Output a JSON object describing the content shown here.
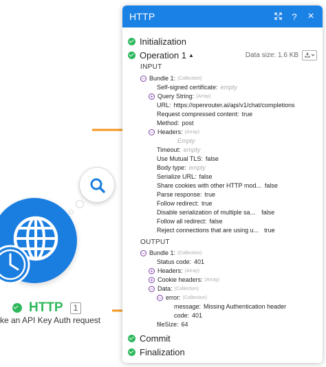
{
  "panel": {
    "title": "HTTP",
    "header_icons": [
      "expand-icon",
      "help-icon",
      "close-icon"
    ],
    "help_label": "?",
    "close_label": "×",
    "accent_color": "#1b82e5",
    "success_color": "#2eb85c",
    "sections": {
      "initialization": "Initialization",
      "operation": "Operation 1",
      "data_size": "Data size: 1.6 KB",
      "commit": "Commit",
      "finalization": "Finalization"
    },
    "input_label": "INPUT",
    "output_label": "OUTPUT",
    "input": {
      "bundle": "Bundle 1:",
      "bundle_tag": "(Collection)",
      "self_signed": "Self-signed certificate:",
      "empty": "empty",
      "query_string": "Query String:",
      "array_tag": "(Array)",
      "url_label": "URL:",
      "url_value": "https://openrouter.ai/api/v1/chat/completions",
      "request_compressed": "Request compressed content:",
      "true_value": "true",
      "false_value": "false",
      "method_label": "Method:",
      "method_value": "post",
      "headers": "Headers:",
      "headers_empty": "Empty",
      "timeout": "Timeout:",
      "use_mutual_tls": "Use Mutual TLS:",
      "body_type": "Body type:",
      "serialize_url": "Serialize URL:",
      "share_cookies": "Share cookies with other HTTP mod...",
      "parse_response": "Parse response:",
      "follow_redirect": "Follow redirect:",
      "disable_serialization": "Disable serialization of multiple sa...",
      "follow_all_redirect": "Follow all redirect:",
      "reject_connections": "Reject connections that are using u..."
    },
    "output": {
      "bundle": "Bundle 1:",
      "bundle_tag": "(Collection)",
      "status_code_label": "Status code:",
      "status_code_value": "401",
      "headers": "Headers:",
      "array_tag": "(Array)",
      "cookie_headers": "Cookie headers:",
      "data": "Data:",
      "collection_tag": "(Collection)",
      "error": "error:",
      "message_label": "message:",
      "message_value": "Missing Authentication header",
      "code_label": "code:",
      "code_value": "401",
      "filesize_label": "fileSize:",
      "filesize_value": "64"
    }
  },
  "module": {
    "name": "HTTP",
    "count": "1",
    "subtitle": "ke an API Key Auth request",
    "color": "#1a7de0"
  },
  "annotation": {
    "arrow_color": "#f2961f"
  }
}
